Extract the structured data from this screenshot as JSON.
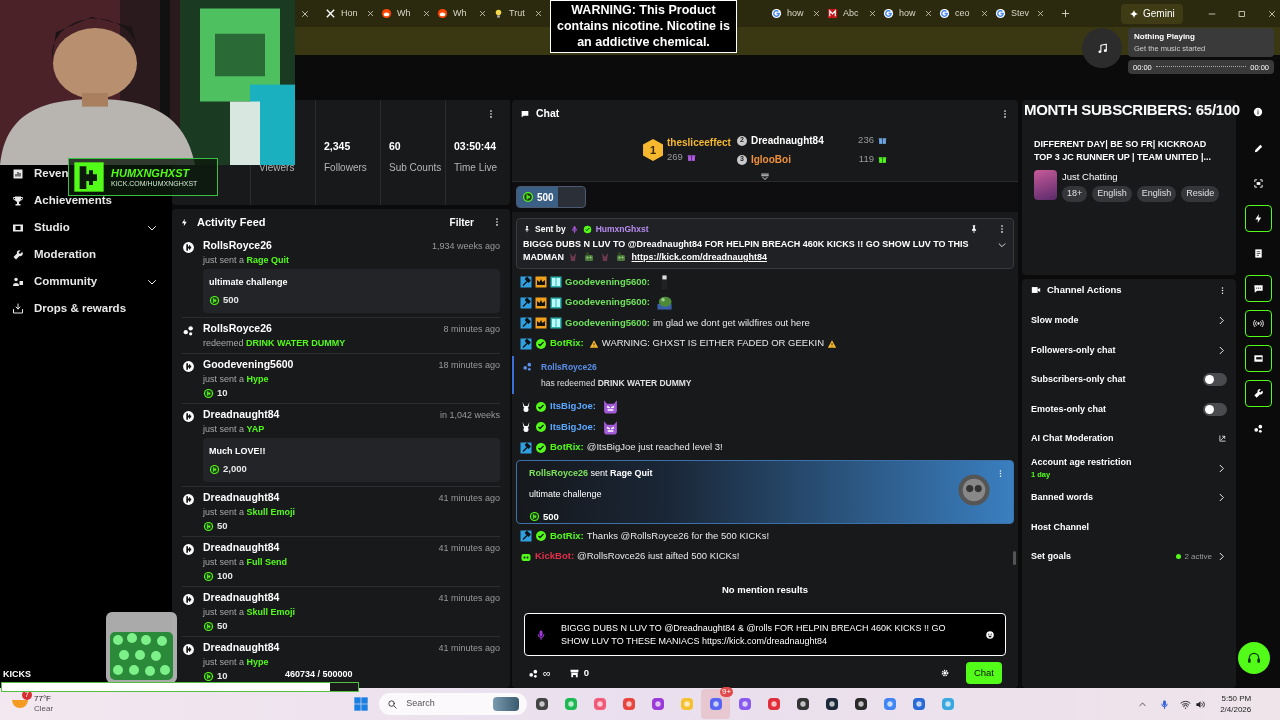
{
  "browser": {
    "tabs_left": [
      {
        "label": "Hon",
        "selected": false
      },
      {
        "label": "Wh",
        "selected": false
      },
      {
        "label": "Wh",
        "selected": false
      },
      {
        "label": "Trut",
        "selected": false
      }
    ],
    "tabs_right": [
      {
        "label": "how",
        "selected": false
      },
      {
        "label": "Abc",
        "selected": false
      },
      {
        "label": "how",
        "selected": false
      },
      {
        "label": "ceo",
        "selected": false
      },
      {
        "label": "Stev",
        "selected": false
      }
    ],
    "gemini": "Gemini"
  },
  "warning_overlay": "WARNING: This Product contains nicotine. Nicotine is an addictive chemical.",
  "media": {
    "title": "Nothing Playing",
    "subtitle": "Get the music started",
    "elapsed": "00:00",
    "duration": "00:00"
  },
  "logo_overlay": {
    "name": "HUMXNGHXST",
    "url": "KICK.COM/HUMXNGHXST"
  },
  "sidebar": {
    "items": [
      {
        "label": "Reven",
        "expandable": false
      },
      {
        "label": "Achievements",
        "expandable": false
      },
      {
        "label": "Studio",
        "expandable": true
      },
      {
        "label": "Moderation",
        "expandable": false
      },
      {
        "label": "Community",
        "expandable": true
      },
      {
        "label": "Drops & rewards",
        "expandable": false
      }
    ]
  },
  "stats": [
    {
      "label": "Viewers"
    },
    {
      "value": "2,345",
      "label": "Followers"
    },
    {
      "value": "60",
      "label": "Sub Counts"
    },
    {
      "value": "03:50:44",
      "label": "Time Live"
    }
  ],
  "activity_feed": {
    "title": "Activity Feed",
    "filter": "Filter",
    "items": [
      {
        "kind": "kicks",
        "user": "RollsRoyce26",
        "action": "just sent a",
        "item": "Rage Quit",
        "time": "1,934 weeks ago",
        "message": "ultimate challenge",
        "amount": "500"
      },
      {
        "kind": "redeem",
        "user": "RollsRoyce26",
        "action": "redeemed",
        "item": "DRINK WATER DUMMY",
        "time": "8 minutes ago"
      },
      {
        "kind": "kicks",
        "user": "Goodevening5600",
        "action": "just sent a",
        "item": "Hype",
        "time": "18 minutes ago",
        "amount": "10"
      },
      {
        "kind": "kicks",
        "user": "Dreadnaught84",
        "action": "just sent a",
        "item": "YAP",
        "time": "in 1,042 weeks",
        "message": "Much LOVE!!",
        "amount": "2,000"
      },
      {
        "kind": "kicks",
        "user": "Dreadnaught84",
        "action": "just sent a",
        "item": "Skull Emoji",
        "time": "41 minutes ago",
        "amount": "50"
      },
      {
        "kind": "kicks",
        "user": "Dreadnaught84",
        "action": "just sent a",
        "item": "Full Send",
        "time": "41 minutes ago",
        "amount": "100"
      },
      {
        "kind": "kicks",
        "user": "Dreadnaught84",
        "action": "just sent a",
        "item": "Skull Emoji",
        "time": "41 minutes ago",
        "amount": "50"
      },
      {
        "kind": "kicks",
        "user": "Dreadnaught84",
        "action": "just sent a",
        "item": "Hype",
        "time": "41 minutes ago",
        "amount": "10"
      }
    ]
  },
  "chat": {
    "title": "Chat",
    "leaderboard": [
      {
        "rank": "1",
        "user": "thesliceeffect",
        "count": "269",
        "color": "#f5b82e"
      },
      {
        "rank": "2",
        "user": "Dreadnaught84",
        "count": "236",
        "color": "#ffffff"
      },
      {
        "rank": "3",
        "user": "IglooBoi",
        "count": "119",
        "color": "#f0913a"
      }
    ],
    "kick_chip": {
      "amount": "500",
      "level": 0.6
    },
    "pinned": {
      "label": "Sent by",
      "user": "HumxnGhxst",
      "text": "BIGGG DUBS N LUV TO @Dreadnaught84 FOR HELPIN BREACH 460K KICKS !! GO SHOW LUV TO THIS MADMAN",
      "link": "https://kick.com/dreadnaught84"
    },
    "messages": [
      {
        "kind": "member",
        "user": "Goodevening5600:",
        "color": "#6fe05c",
        "emote": {
          "kind": "figure"
        }
      },
      {
        "kind": "member",
        "user": "Goodevening5600:",
        "color": "#6fe05c",
        "emote": {
          "kind": "frog"
        }
      },
      {
        "kind": "member",
        "user": "Goodevening5600:",
        "color": "#6fe05c",
        "text": "im glad we dont get wildfires out here"
      },
      {
        "kind": "bot",
        "user": "BotRix:",
        "color": "#53fc18",
        "text": "WARNING: GHXST IS EITHER FADED OR GEEKIN",
        "warn": true
      },
      {
        "kind": "redeem",
        "user": "RollsRoyce26",
        "text": "has redeemed **DRINK WATER DUMMY**"
      },
      {
        "kind": "fan",
        "user": "ItsBigJoe:",
        "color": "#5aa7ff",
        "emote": {
          "kind": "devil"
        }
      },
      {
        "kind": "fan",
        "user": "ItsBigJoe:",
        "color": "#5aa7ff",
        "emote": {
          "kind": "devil"
        }
      },
      {
        "kind": "bot",
        "user": "BotRix:",
        "color": "#53fc18",
        "text": "@ItsBigJoe just reached level 3!"
      },
      {
        "kind": "gift",
        "user": "RollsRoyce26",
        "action": "sent",
        "item": "Rage Quit",
        "message": "ultimate challenge",
        "amount": "500"
      },
      {
        "kind": "bot",
        "user": "BotRix:",
        "color": "#53fc18",
        "text": "Thanks @RollsRoyce26 for the 500 KICKs!"
      },
      {
        "kind": "kickbot",
        "user": "KickBot:",
        "color": "#e0304a",
        "text": "@RollsRovce26 iust aifted 500 KICKs!"
      }
    ],
    "notice": "No mention results",
    "input": "BIGGG DUBS N LUV TO @Dreadnaught84 & @rolls FOR HELPIN BREACH 460K KICKS !! GO SHOW LUV TO THESE MANIACS  https://kick.com/dreadnaught84",
    "points": "∞",
    "store": "0",
    "send": "Chat"
  },
  "subs_overlay": "MONTH SUBSCRIBERS: 65/100",
  "stream_info": {
    "title": "DIFFERENT DAY| BE SO FR| KICKROAD TOP 3 JC RUNNER UP | TEAM UNITED |...",
    "category": "Just Chatting",
    "tags": [
      "18+",
      "English",
      "English",
      "Reside"
    ]
  },
  "channel_actions": {
    "title": "Channel Actions",
    "items": [
      {
        "kind": "link",
        "label": "Slow mode"
      },
      {
        "kind": "link",
        "label": "Followers-only chat"
      },
      {
        "kind": "toggle",
        "label": "Subscribers-only chat",
        "on": false
      },
      {
        "kind": "toggle",
        "label": "Emotes-only chat",
        "on": false
      },
      {
        "kind": "external",
        "label": "AI Chat Moderation"
      },
      {
        "kind": "link",
        "label": "Account age restriction",
        "value": "1 day"
      },
      {
        "kind": "link",
        "label": "Banned words"
      },
      {
        "kind": "plain",
        "label": "Host Channel"
      },
      {
        "kind": "link",
        "label": "Set goals",
        "status": "2 active"
      }
    ]
  },
  "rail": [
    {
      "kind": "pencil",
      "active": false
    },
    {
      "kind": "frame",
      "active": false
    },
    {
      "kind": "bolt",
      "active": true
    },
    {
      "kind": "doc",
      "active": false
    },
    {
      "kind": "chat",
      "active": true
    },
    {
      "kind": "broadcast",
      "active": true
    },
    {
      "kind": "video",
      "active": true
    },
    {
      "kind": "wrench",
      "active": true
    },
    {
      "kind": "dots",
      "active": false
    }
  ],
  "kicks_goal": {
    "label": "KICKS",
    "progress": "460734 / 500000",
    "level": 0.92
  },
  "taskbar": {
    "weather": {
      "badge": "7",
      "temp": "77°F",
      "condition": "Clear"
    },
    "search": "Search",
    "app_badge": "9+",
    "time": "5:50 PM",
    "date": "2/4/2026"
  }
}
